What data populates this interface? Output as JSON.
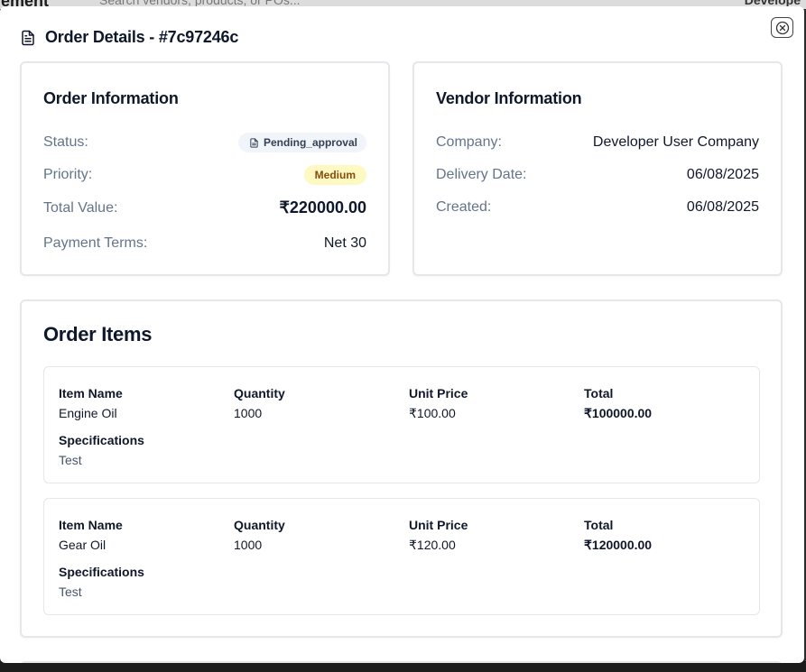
{
  "backdrop": {
    "title": "rement",
    "search_placeholder": "Search vendors, products, or POs...",
    "user": "Develope"
  },
  "modal": {
    "title": "Order Details - #7c97246c",
    "title_icon": "document-icon",
    "close_icon": "close-circle-icon"
  },
  "order_info": {
    "heading": "Order Information",
    "status_label": "Status:",
    "status_value": "Pending_approval",
    "status_icon": "document-icon",
    "priority_label": "Priority:",
    "priority_value": "Medium",
    "total_label": "Total Value:",
    "total_value": "₹220000.00",
    "payment_label": "Payment Terms:",
    "payment_value": "Net 30"
  },
  "vendor_info": {
    "heading": "Vendor Information",
    "company_label": "Company:",
    "company_value": "Developer User Company",
    "delivery_label": "Delivery Date:",
    "delivery_value": "06/08/2025",
    "created_label": "Created:",
    "created_value": "06/08/2025"
  },
  "order_items": {
    "heading": "Order Items",
    "labels": {
      "name": "Item Name",
      "quantity": "Quantity",
      "unit_price": "Unit Price",
      "total": "Total",
      "specs": "Specifications"
    },
    "items": [
      {
        "name": "Engine Oil",
        "quantity": "1000",
        "unit_price": "₹100.00",
        "total": "₹100000.00",
        "specs": "Test"
      },
      {
        "name": "Gear Oil",
        "quantity": "1000",
        "unit_price": "₹120.00",
        "total": "₹120000.00",
        "specs": "Test"
      }
    ]
  },
  "colors": {
    "status_badge_bg": "#f1f5f9",
    "priority_badge_bg": "#fef9c3",
    "priority_badge_text": "#854d0e",
    "muted_text": "#64748b",
    "border": "#e5e7eb"
  }
}
